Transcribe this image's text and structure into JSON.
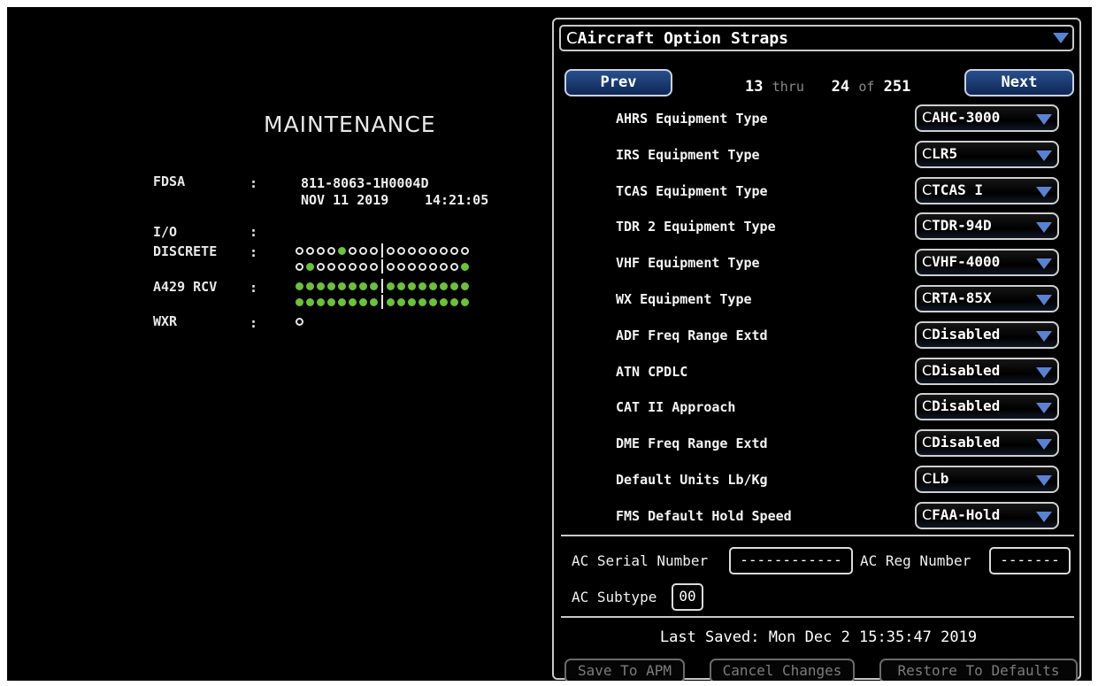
{
  "maintenance": {
    "title": "MAINTENANCE",
    "fdsa_label": "FDSA",
    "fdsa_part": "811-8063-1H0004D",
    "fdsa_date": "NOV 11 2019",
    "fdsa_time": "14:21:05",
    "io_label": "I/O",
    "discrete_label": "DISCRETE",
    "a429_label": "A429 RCV",
    "wxr_label": "WXR",
    "colon": ":",
    "discrete_rows": [
      [
        0,
        0,
        0,
        0,
        1,
        0,
        0,
        0,
        0,
        0,
        0,
        0,
        0,
        0,
        0,
        0
      ],
      [
        0,
        1,
        0,
        0,
        0,
        0,
        0,
        0,
        0,
        0,
        0,
        0,
        0,
        0,
        0,
        1
      ]
    ],
    "a429_rows": [
      [
        1,
        1,
        1,
        1,
        1,
        1,
        1,
        1,
        1,
        1,
        1,
        1,
        1,
        1,
        1,
        1
      ],
      [
        1,
        1,
        1,
        1,
        1,
        1,
        1,
        1,
        1,
        1,
        1,
        1,
        1,
        1,
        1,
        1
      ]
    ],
    "wxr_row": [
      0
    ],
    "status_colors": {
      "on": "#6cc03c",
      "off": "#000000"
    }
  },
  "panel": {
    "title": "Aircraft Option Straps",
    "clear_glyph": "C",
    "prev_label": "Prev",
    "next_label": "Next",
    "range_start": "13",
    "range_thru": "thru",
    "range_end": "24",
    "range_of": "of",
    "range_total": "251",
    "options": [
      {
        "label": "AHRS Equipment Type",
        "value": "AHC-3000"
      },
      {
        "label": "IRS Equipment Type",
        "value": "LR5"
      },
      {
        "label": "TCAS Equipment Type",
        "value": "TCAS I"
      },
      {
        "label": "TDR 2 Equipment Type",
        "value": "TDR-94D"
      },
      {
        "label": "VHF Equipment Type",
        "value": "VHF-4000"
      },
      {
        "label": "WX Equipment Type",
        "value": "RTA-85X"
      },
      {
        "label": "ADF Freq Range Extd",
        "value": "Disabled"
      },
      {
        "label": "ATN CPDLC",
        "value": "Disabled"
      },
      {
        "label": "CAT II Approach",
        "value": "Disabled"
      },
      {
        "label": "DME Freq Range Extd",
        "value": "Disabled"
      },
      {
        "label": "Default Units Lb/Kg",
        "value": "Lb"
      },
      {
        "label": "FMS Default Hold Speed",
        "value": "FAA-Hold"
      }
    ],
    "serial_label": "AC Serial Number",
    "serial_value": "------------",
    "reg_label": "AC Reg Number",
    "reg_value": "-------",
    "subtype_label": "AC Subtype",
    "subtype_value": "00",
    "last_saved": "Last Saved: Mon Dec  2 15:35:47 2019",
    "save_label": "Save To APM",
    "cancel_label": "Cancel Changes",
    "restore_label": "Restore To Defaults",
    "accent_color": "#5a82d2"
  }
}
